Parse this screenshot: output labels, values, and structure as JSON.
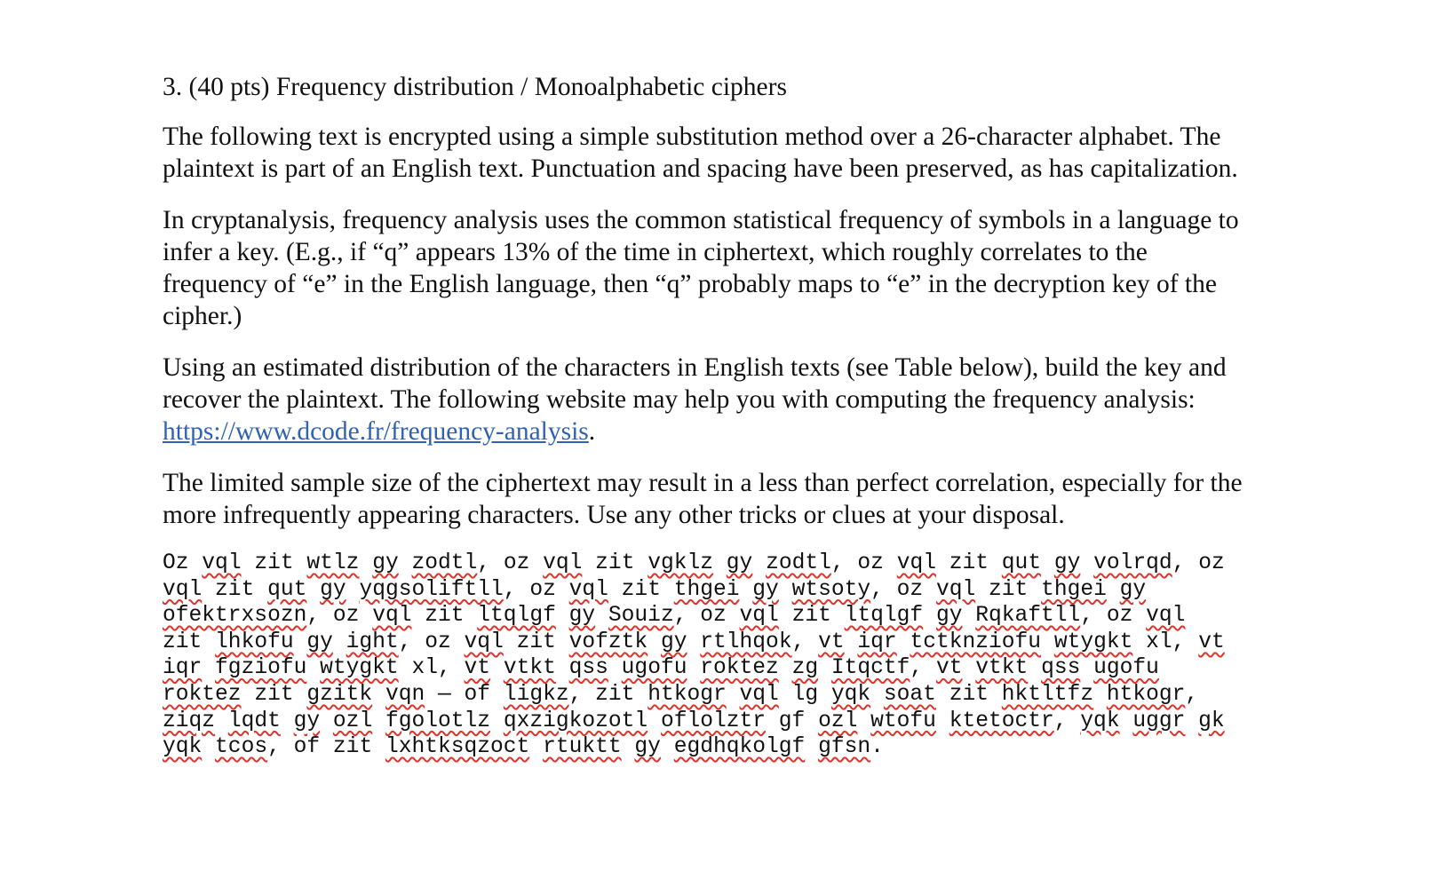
{
  "document": {
    "heading": "3. (40 pts) Frequency distribution / Monoalphabetic ciphers",
    "paragraphs": {
      "p1": "The following text is encrypted using a simple substitution method over a 26-character alphabet. The plaintext is part of an English text. Punctuation and spacing have been preserved, as has capitalization.",
      "p2": "In cryptanalysis, frequency analysis uses the common statistical frequency of symbols in a language to infer a key.  (E.g., if “q” appears 13% of the time in ciphertext, which roughly correlates to the frequency of “e” in the English language, then “q” probably maps to “e” in the decryption key of the cipher.)",
      "p3_before_link": "Using an estimated distribution of the characters in English texts (see Table below), build the key and recover the plaintext. The following website may help you with computing the frequency analysis: ",
      "p3_link": "https://www.dcode.fr/frequency-analysis",
      "p3_after_link": ".",
      "p4": "The limited sample size of the ciphertext may result in a less than perfect correlation, especially for the more infrequently appearing characters.  Use any other tricks or clues at your disposal."
    },
    "ciphertext": [
      {
        "t": "Oz",
        "s": false
      },
      {
        "t": "vql",
        "s": true
      },
      {
        "t": "zit",
        "s": false
      },
      {
        "t": "wtlz",
        "s": true
      },
      {
        "t": "gy",
        "s": true
      },
      {
        "t": "zodtl",
        "s": true,
        "p": ","
      },
      {
        "t": "oz",
        "s": false
      },
      {
        "t": "vql",
        "s": true
      },
      {
        "t": "zit",
        "s": false
      },
      {
        "t": "vgklz",
        "s": true
      },
      {
        "t": "gy",
        "s": true
      },
      {
        "t": "zodtl",
        "s": true,
        "p": ","
      },
      {
        "t": "oz",
        "s": false
      },
      {
        "t": "vql",
        "s": true
      },
      {
        "t": "zit",
        "s": false
      },
      {
        "t": "qut",
        "s": true
      },
      {
        "t": "gy",
        "s": true
      },
      {
        "t": "volrqd",
        "s": true,
        "p": ","
      },
      {
        "t": "oz",
        "s": false
      },
      {
        "t": "vql",
        "s": true
      },
      {
        "t": "zit",
        "s": false
      },
      {
        "t": "qut",
        "s": true
      },
      {
        "t": "gy",
        "s": true
      },
      {
        "t": "yqgsoliftll",
        "s": true,
        "p": ","
      },
      {
        "t": "oz",
        "s": false
      },
      {
        "t": "vql",
        "s": true
      },
      {
        "t": "zit",
        "s": false
      },
      {
        "t": "thgei",
        "s": true
      },
      {
        "t": "gy",
        "s": true
      },
      {
        "t": "wtsoty",
        "s": true,
        "p": ","
      },
      {
        "t": "oz",
        "s": false
      },
      {
        "t": "vql",
        "s": true
      },
      {
        "t": "zit",
        "s": false
      },
      {
        "t": "thgei",
        "s": true
      },
      {
        "t": "gy",
        "s": true
      },
      {
        "t": "ofektrxsozn",
        "s": true,
        "p": ","
      },
      {
        "t": "oz",
        "s": false
      },
      {
        "t": "vql",
        "s": true
      },
      {
        "t": "zit",
        "s": false
      },
      {
        "t": "ltqlgf",
        "s": true
      },
      {
        "t": "gy",
        "s": true
      },
      {
        "t": "Souiz",
        "s": true,
        "p": ","
      },
      {
        "t": "oz",
        "s": false
      },
      {
        "t": "vql",
        "s": true
      },
      {
        "t": "zit",
        "s": false
      },
      {
        "t": "ltqlgf",
        "s": true
      },
      {
        "t": "gy",
        "s": true
      },
      {
        "t": "Rqkaftll",
        "s": true,
        "p": ","
      },
      {
        "t": "oz",
        "s": false
      },
      {
        "t": "vql",
        "s": true
      },
      {
        "t": "zit",
        "s": false
      },
      {
        "t": "lhkofu",
        "s": true
      },
      {
        "t": "gy",
        "s": true
      },
      {
        "t": "ight",
        "s": true,
        "p": ","
      },
      {
        "t": "oz",
        "s": false
      },
      {
        "t": "vql",
        "s": true
      },
      {
        "t": "zit",
        "s": false
      },
      {
        "t": "vofztk",
        "s": true
      },
      {
        "t": "gy",
        "s": true
      },
      {
        "t": "rtlhqok",
        "s": true,
        "p": ","
      },
      {
        "t": "vt",
        "s": true
      },
      {
        "t": "iqr",
        "s": true
      },
      {
        "t": "tctknziofu",
        "s": true
      },
      {
        "t": "wtygkt",
        "s": true
      },
      {
        "t": "xl",
        "s": false,
        "p": ","
      },
      {
        "t": "vt",
        "s": true
      },
      {
        "t": "iqr",
        "s": true
      },
      {
        "t": "fgziofu",
        "s": true
      },
      {
        "t": "wtygkt",
        "s": true
      },
      {
        "t": "xl",
        "s": false,
        "p": ","
      },
      {
        "t": "vt",
        "s": true
      },
      {
        "t": "vtkt",
        "s": true
      },
      {
        "t": "qss",
        "s": true
      },
      {
        "t": "ugofu",
        "s": true
      },
      {
        "t": "roktez",
        "s": true
      },
      {
        "t": "zg",
        "s": true
      },
      {
        "t": "Itqctf",
        "s": true,
        "p": ","
      },
      {
        "t": "vt",
        "s": true
      },
      {
        "t": "vtkt",
        "s": true
      },
      {
        "t": "qss",
        "s": true
      },
      {
        "t": "ugofu",
        "s": true
      },
      {
        "t": "roktez",
        "s": true
      },
      {
        "t": "zit",
        "s": false
      },
      {
        "t": "gzitk",
        "s": true
      },
      {
        "t": "vqn",
        "s": true
      },
      {
        "t": "—",
        "s": false
      },
      {
        "t": "of",
        "s": false
      },
      {
        "t": "ligkz",
        "s": true,
        "p": ","
      },
      {
        "t": "zit",
        "s": false
      },
      {
        "t": "htkogr",
        "s": true
      },
      {
        "t": "vql",
        "s": true
      },
      {
        "t": "lg",
        "s": false
      },
      {
        "t": "yqk",
        "s": true
      },
      {
        "t": "soat",
        "s": true
      },
      {
        "t": "zit",
        "s": false
      },
      {
        "t": "hktltfz",
        "s": true
      },
      {
        "t": "htkogr",
        "s": true,
        "p": ","
      },
      {
        "t": "ziqz",
        "s": true
      },
      {
        "t": "lqdt",
        "s": true
      },
      {
        "t": "gy",
        "s": true
      },
      {
        "t": "ozl",
        "s": true
      },
      {
        "t": "fgolotlz",
        "s": true
      },
      {
        "t": "qxzigkozotl",
        "s": true
      },
      {
        "t": "oflolztr",
        "s": true
      },
      {
        "t": "gf",
        "s": false
      },
      {
        "t": "ozl",
        "s": true
      },
      {
        "t": "wtofu",
        "s": true
      },
      {
        "t": "ktetoctr",
        "s": true,
        "p": ","
      },
      {
        "t": "yqk",
        "s": true
      },
      {
        "t": "uggr",
        "s": true
      },
      {
        "t": "gk",
        "s": true
      },
      {
        "t": "yqk",
        "s": true
      },
      {
        "t": "tcos",
        "s": true,
        "p": ","
      },
      {
        "t": "of",
        "s": false
      },
      {
        "t": "zit",
        "s": false
      },
      {
        "t": "lxhtksqzoct",
        "s": true
      },
      {
        "t": "rtuktt",
        "s": true
      },
      {
        "t": "gy",
        "s": true
      },
      {
        "t": "egdhqkolgf",
        "s": true
      },
      {
        "t": "gfsn",
        "s": true,
        "p": "."
      }
    ]
  }
}
